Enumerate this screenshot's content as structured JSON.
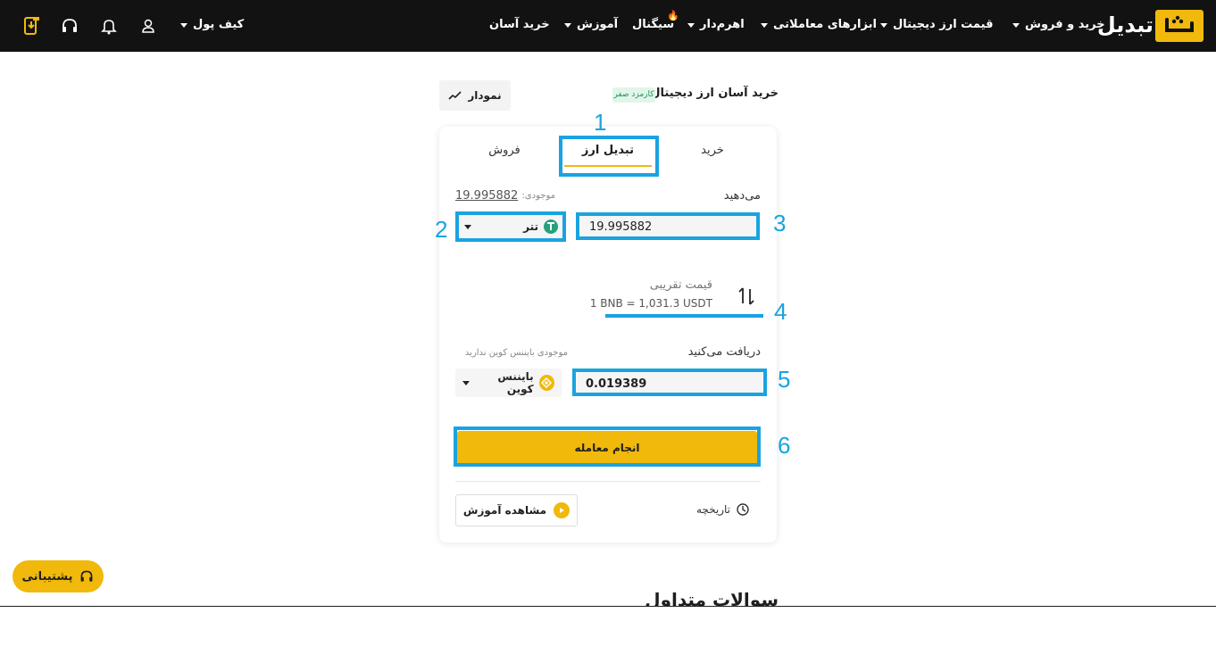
{
  "brand": {
    "name": "تبدیل"
  },
  "nav": {
    "items": [
      {
        "label": "خرید و فروش",
        "has_caret": true
      },
      {
        "label": "قیمت ارز دیجیتال",
        "has_caret": true
      },
      {
        "label": "ابزارهای معاملاتی",
        "has_caret": true
      },
      {
        "label": "اهرم‌دار",
        "has_caret": true
      },
      {
        "label": "سیگنال",
        "has_caret": false
      },
      {
        "label": "آموزش",
        "has_caret": true
      },
      {
        "label": "خرید آسان",
        "has_caret": false
      }
    ],
    "wallet_label": "کیف پول",
    "icons": [
      "user-icon",
      "bell-icon",
      "headset-icon",
      "download-app-icon"
    ]
  },
  "section": {
    "title": "خرید آسان ارز دیجیتال",
    "badge": "کارمزد صفر",
    "chart_button": "نمودار"
  },
  "card": {
    "tabs": [
      "خرید",
      "تبدیل ارز",
      "فروش"
    ],
    "active_tab": "تبدیل ارز",
    "give": {
      "label": "می‌دهید",
      "balance_label": "موجودی:",
      "balance_value": "19.995882",
      "coin": "تتر",
      "amount": "19.995882"
    },
    "rate": {
      "label": "قیمت تقریبی",
      "value": "1 BNB = 1,031.3 USDT"
    },
    "receive": {
      "label": "دریافت می‌کنید",
      "balance_note": "موجودی بایننس کوین ندارید",
      "coin": "بایننس کوین",
      "amount": "0.019389"
    },
    "submit_button": "انجام معامله",
    "history_label": "تاریخچه",
    "tutorial_button": "مشاهده آموزش"
  },
  "annotations": [
    "1",
    "2",
    "3",
    "4",
    "5",
    "6"
  ],
  "faq_title": "سوالات متداول",
  "support_button": "پشتیبانی",
  "colors": {
    "accent": "#f0b90b",
    "navbar": "#121212",
    "annotation": "#1aa3e0",
    "tether": "#26a17b",
    "badge_green": "#1a9c55"
  }
}
